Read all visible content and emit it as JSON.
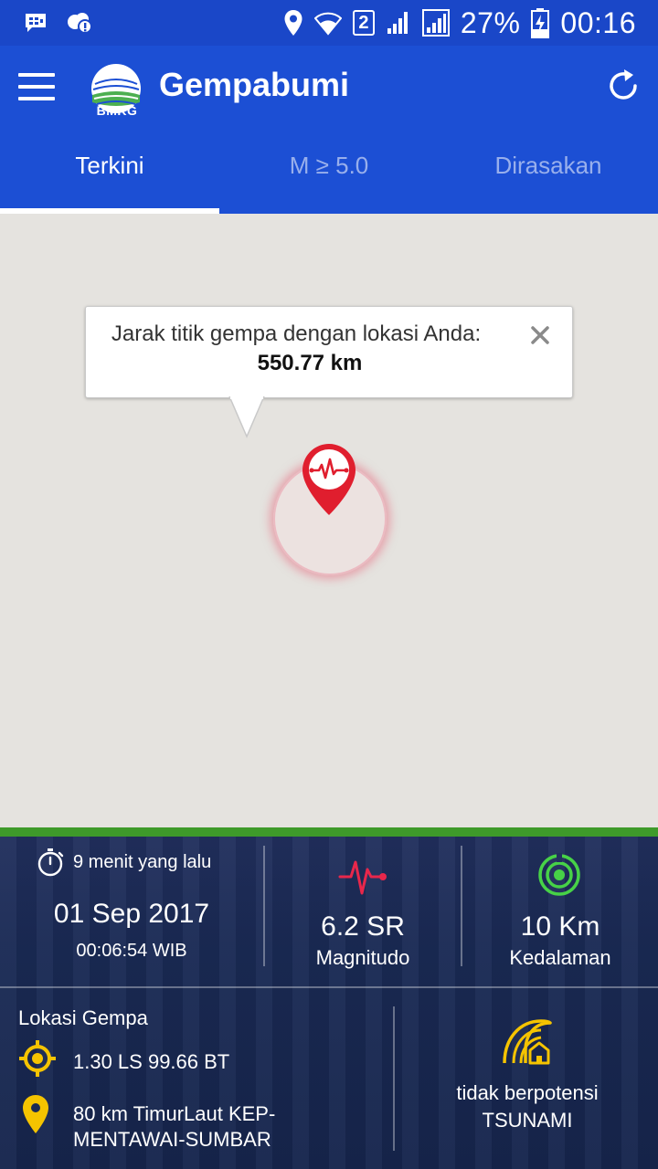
{
  "status_bar": {
    "battery": "27%",
    "time": "00:16",
    "sim_slot": "2"
  },
  "app_bar": {
    "logo_text": "BMKG",
    "title": "Gempabumi",
    "tabs": [
      {
        "label": "Terkini",
        "active": true
      },
      {
        "label": "M ≥ 5.0",
        "active": false
      },
      {
        "label": "Dirasakan",
        "active": false
      }
    ]
  },
  "map": {
    "info_window": {
      "title": "Jarak titik gempa dengan lokasi Anda:",
      "distance": "550.77 km"
    }
  },
  "panel": {
    "time_ago": "9 menit yang lalu",
    "date": "01 Sep 2017",
    "time": "00:06:54 WIB",
    "magnitude_value": "6.2 SR",
    "magnitude_label": "Magnitudo",
    "depth_value": "10 Km",
    "depth_label": "Kedalaman",
    "location_title": "Lokasi Gempa",
    "coordinates": "1.30 LS 99.66 BT",
    "place": "80 km TimurLaut KEP-MENTAWAI-SUMBAR",
    "tsunami_line1": "tidak berpotensi",
    "tsunami_line2": "TSUNAMI"
  },
  "colors": {
    "status_bar": "#1a47c8",
    "app_bar": "#1c4fd4",
    "map_bg": "#e5e3df",
    "panel_accent": "#3e9a2a",
    "magnitude_icon": "#e8274b",
    "depth_icon": "#47d247",
    "location_icon": "#f5c400"
  },
  "icons": {
    "status_left": [
      "bbm-chat-icon",
      "weather-alert-icon"
    ],
    "status_right": [
      "location-icon",
      "wifi-icon",
      "sim-2-icon",
      "signal-icon",
      "signal-icon",
      "battery-charging-icon"
    ],
    "app": [
      "menu-icon",
      "bmkg-logo",
      "refresh-icon"
    ],
    "panel": [
      "stopwatch-icon",
      "seismograph-icon",
      "depth-radar-icon",
      "target-icon",
      "map-pin-icon",
      "tsunami-icon"
    ]
  }
}
